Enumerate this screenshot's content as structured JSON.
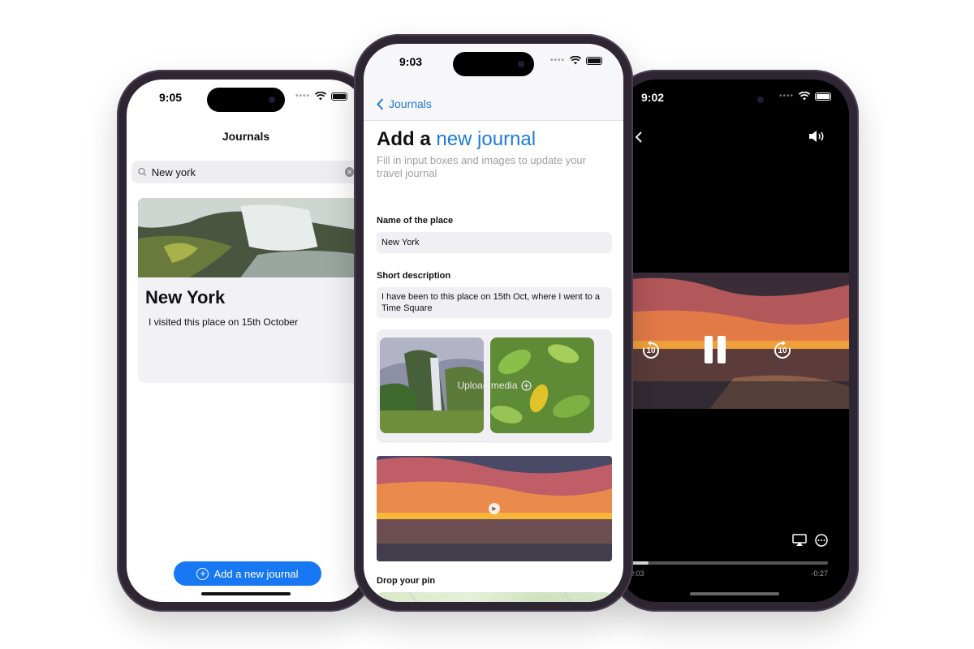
{
  "phones": {
    "left": {
      "status_time": "9:05",
      "nav_title": "Journals",
      "search_value": "New york",
      "card": {
        "title": "New York",
        "description": "I visited this place on 15th October"
      },
      "add_button_label": "Add a new journal"
    },
    "center": {
      "status_time": "9:03",
      "back_label": "Journals",
      "heading_prefix": "Add a",
      "heading_accent": "new journal",
      "subheading": "Fill in input boxes and images to update your travel journal",
      "name_label": "Name of the place",
      "name_value": "New York",
      "description_label": "Short description",
      "description_value": "I have been to this place on 15th Oct, where I went to a Time Square",
      "upload_label": "Upload media",
      "pin_label": "Drop your pin"
    },
    "right": {
      "status_time": "9:02",
      "rewind_label": "10",
      "forward_label": "10",
      "elapsed": "0:03",
      "remaining": "-0:27",
      "progress": 0.1
    }
  },
  "colors": {
    "accent": "#1e7bd8",
    "button": "#1877f2",
    "frame": "#2e2733"
  },
  "icons": [
    "search-icon",
    "clear-icon",
    "plus-circle-icon",
    "chevron-left-icon",
    "wifi-icon",
    "battery-icon",
    "volume-icon",
    "airplay-icon",
    "more-icon",
    "pause-icon",
    "rewind-10-icon",
    "forward-10-icon",
    "play-icon"
  ]
}
